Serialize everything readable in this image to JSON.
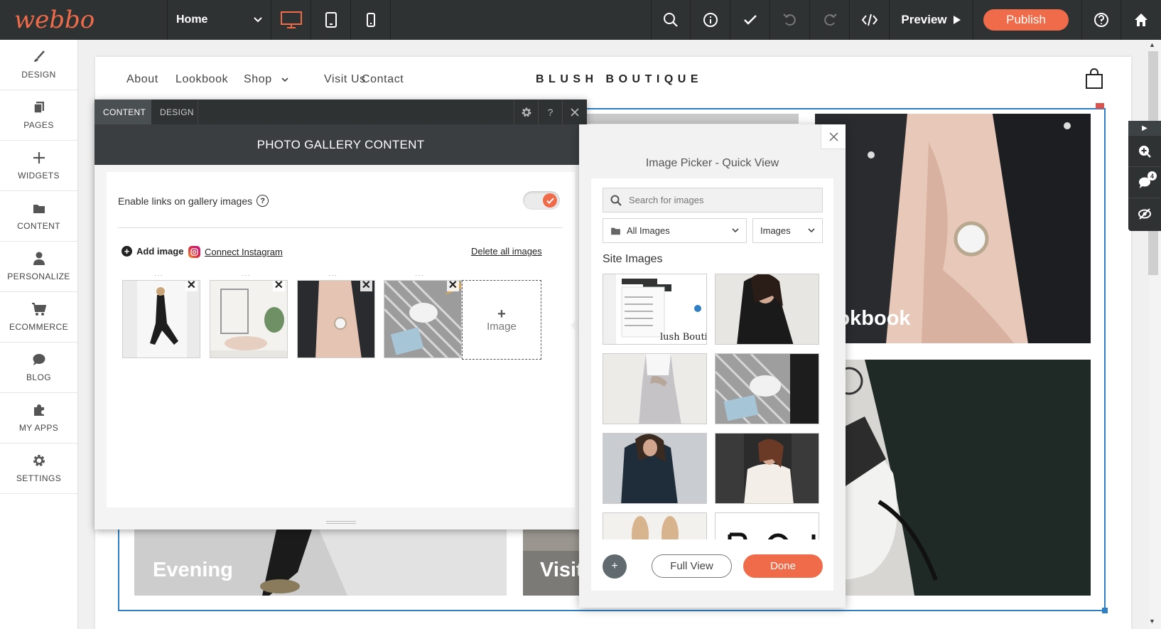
{
  "app": {
    "logo": "webbo",
    "page_select": "Home",
    "preview_label": "Preview",
    "publish_label": "Publish",
    "accent_color": "#ef6b4a"
  },
  "sidebar": {
    "items": [
      {
        "label": "DESIGN",
        "icon": "brush-icon"
      },
      {
        "label": "PAGES",
        "icon": "pages-icon"
      },
      {
        "label": "WIDGETS",
        "icon": "plus-icon"
      },
      {
        "label": "CONTENT",
        "icon": "folder-icon"
      },
      {
        "label": "PERSONALIZE",
        "icon": "person-icon"
      },
      {
        "label": "ECOMMERCE",
        "icon": "cart-icon"
      },
      {
        "label": "BLOG",
        "icon": "chat-bubble-icon"
      },
      {
        "label": "MY APPS",
        "icon": "puzzle-icon"
      },
      {
        "label": "SETTINGS",
        "icon": "gear-icon"
      }
    ]
  },
  "site": {
    "nav": [
      "About",
      "Lookbook",
      "Shop",
      "Visit Us",
      "Contact"
    ],
    "brand": "BLUSH BOUTIQUE",
    "gallery_labels": {
      "lookbook": "Lookbook",
      "evening": "Evening",
      "visit": "Visit"
    }
  },
  "gallery_panel": {
    "tabs": [
      "CONTENT",
      "DESIGN"
    ],
    "title": "PHOTO GALLERY CONTENT",
    "enable_links_label": "Enable links on gallery images",
    "enable_links_on": true,
    "add_image": "Add image",
    "connect_instagram": "Connect Instagram",
    "delete_all": "Delete all images",
    "add_tile_label": "Image"
  },
  "image_picker": {
    "title": "Image Picker - Quick View",
    "search_placeholder": "Search for images",
    "folder_select": "All Images",
    "type_select": "Images",
    "section_title": "Site Images",
    "full_view_label": "Full View",
    "done_label": "Done"
  },
  "right_tools": {
    "badge_count": "4"
  }
}
